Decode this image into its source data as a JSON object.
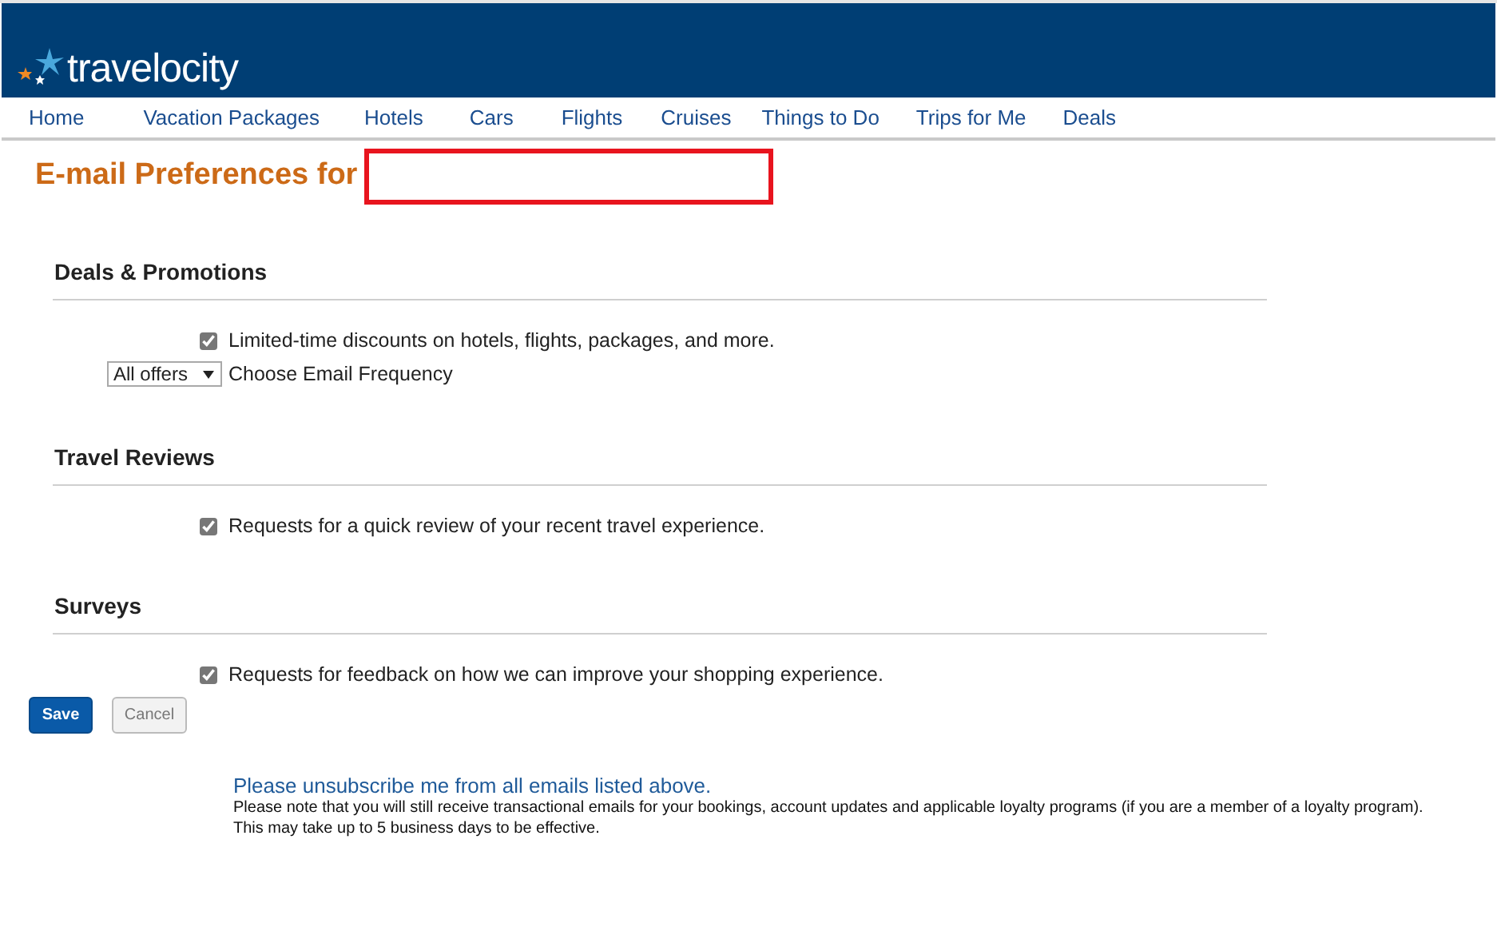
{
  "header": {
    "logo": "travelocity"
  },
  "nav": [
    {
      "label": "Home"
    },
    {
      "label": "Vacation Packages"
    },
    {
      "label": "Hotels"
    },
    {
      "label": "Cars"
    },
    {
      "label": "Flights"
    },
    {
      "label": "Cruises"
    },
    {
      "label": "Things to Do"
    },
    {
      "label": "Trips for Me"
    },
    {
      "label": "Deals"
    }
  ],
  "title": "E-mail Preferences for",
  "sections": [
    {
      "heading": "Deals & Promotions",
      "items": [
        {
          "kind": "checkbox",
          "label": "Limited-time discounts on hotels, flights, packages, and more.",
          "checked": true
        },
        {
          "kind": "select",
          "value": "All offers",
          "label": "Choose Email Frequency"
        }
      ]
    },
    {
      "heading": "Travel Reviews",
      "items": [
        {
          "kind": "checkbox",
          "label": "Requests for a quick review of your recent travel experience.",
          "checked": true
        }
      ]
    },
    {
      "heading": "Surveys",
      "items": [
        {
          "kind": "checkbox",
          "label": "Requests for feedback on how we can improve your shopping experience.",
          "checked": true
        }
      ]
    }
  ],
  "buttons": [
    {
      "label": "Save",
      "kind": "primary"
    },
    {
      "label": "Cancel",
      "kind": "secondary"
    }
  ],
  "unsubscribe": {
    "link": "Please unsubscribe me from all emails listed above.",
    "note_lines": [
      "Please note that you will still receive transactional emails for your bookings, account updates and applicable loyalty programs (if you are a member of a loyalty program).",
      "This may take up to 5 business days to be effective."
    ]
  }
}
